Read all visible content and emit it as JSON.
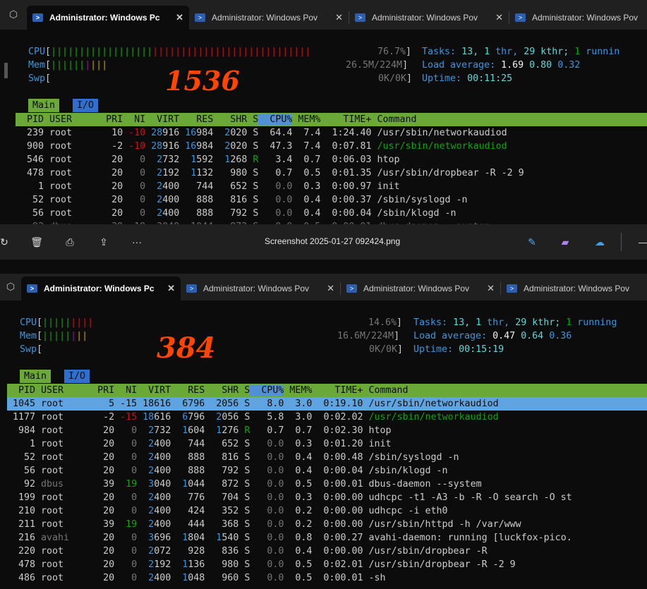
{
  "tabs": {
    "active_title": "Administrator: Windows Pc",
    "inactive_title": "Administrator: Windows Pov",
    "close_glyph": "✕"
  },
  "viewer": {
    "filename": "Screenshot 2025-01-27 092424.png",
    "more": "···"
  },
  "top": {
    "cpu_label": "CPU",
    "mem_label": "Mem",
    "swp_label": "Swp",
    "cpu_value": "76.7%",
    "mem_value": "26.5M/224M",
    "swp_value": "0K/0K",
    "tasks_label": "Tasks:",
    "tasks_text": "13,",
    "thr_value": "1",
    "thr_label": "thr,",
    "kthr_text": "29 kthr;",
    "running_value": "1",
    "running_label": "runnin",
    "load_label": "Load average:",
    "load1": "1.69",
    "load5": "0.80",
    "load15": "0.32",
    "uptime_label": "Uptime:",
    "uptime_value": "00:11:25",
    "annotation": "1536",
    "tab_main": "Main",
    "tab_io": "I/O",
    "rows": [
      [
        "239",
        "root",
        "10",
        "-10",
        "28916",
        "16984",
        "2020",
        "S",
        "64.4",
        "7.4",
        "1:24.40",
        "/usr/sbin/networkaudiod"
      ],
      [
        "900",
        "root",
        "-2",
        "-10",
        "28916",
        "16984",
        "2020",
        "S",
        "47.3",
        "7.4",
        "0:07.81",
        "/usr/sbin/networkaudiod"
      ],
      [
        "546",
        "root",
        "20",
        "0",
        "2732",
        "1592",
        "1268",
        "R",
        "3.4",
        "0.7",
        "0:06.03",
        "htop"
      ],
      [
        "478",
        "root",
        "20",
        "0",
        "2192",
        "1132",
        "980",
        "S",
        "0.7",
        "0.5",
        "0:01.35",
        "/usr/sbin/dropbear -R -2 9"
      ],
      [
        "1",
        "root",
        "20",
        "0",
        "2400",
        "744",
        "652",
        "S",
        "0.0",
        "0.3",
        "0:00.97",
        "init"
      ],
      [
        "52",
        "root",
        "20",
        "0",
        "2400",
        "888",
        "816",
        "S",
        "0.0",
        "0.4",
        "0:00.37",
        "/sbin/syslogd -n"
      ],
      [
        "56",
        "root",
        "20",
        "0",
        "2400",
        "888",
        "792",
        "S",
        "0.0",
        "0.4",
        "0:00.04",
        "/sbin/klogd -n"
      ]
    ]
  },
  "bottom": {
    "cpu_label": "CPU",
    "mem_label": "Mem",
    "swp_label": "Swp",
    "cpu_value": "14.6%",
    "mem_value": "16.6M/224M",
    "swp_value": "0K/0K",
    "tasks_label": "Tasks:",
    "tasks_text": "13,",
    "thr_value": "1",
    "thr_label": "thr,",
    "kthr_text": "29 kthr;",
    "running_value": "1",
    "running_label": "running",
    "load_label": "Load average:",
    "load1": "0.47",
    "load5": "0.64",
    "load15": "0.36",
    "uptime_label": "Uptime:",
    "uptime_value": "00:15:19",
    "annotation": "384",
    "tab_main": "Main",
    "tab_io": "I/O",
    "rows": [
      [
        "1045",
        "root",
        "5",
        "-15",
        "18616",
        "6796",
        "2056",
        "S",
        "8.0",
        "3.0",
        "0:19.10",
        "/usr/sbin/networkaudiod"
      ],
      [
        "1177",
        "root",
        "-2",
        "-15",
        "18616",
        "6796",
        "2056",
        "S",
        "5.8",
        "3.0",
        "0:02.02",
        "/usr/sbin/networkaudiod"
      ],
      [
        "984",
        "root",
        "20",
        "0",
        "2732",
        "1604",
        "1276",
        "R",
        "0.7",
        "0.7",
        "0:02.30",
        "htop"
      ],
      [
        "1",
        "root",
        "20",
        "0",
        "2400",
        "744",
        "652",
        "S",
        "0.0",
        "0.3",
        "0:01.20",
        "init"
      ],
      [
        "52",
        "root",
        "20",
        "0",
        "2400",
        "888",
        "816",
        "S",
        "0.0",
        "0.4",
        "0:00.48",
        "/sbin/syslogd -n"
      ],
      [
        "56",
        "root",
        "20",
        "0",
        "2400",
        "888",
        "792",
        "S",
        "0.0",
        "0.4",
        "0:00.04",
        "/sbin/klogd -n"
      ],
      [
        "92",
        "dbus",
        "39",
        "19",
        "3040",
        "1044",
        "872",
        "S",
        "0.0",
        "0.5",
        "0:00.01",
        "dbus-daemon --system"
      ],
      [
        "199",
        "root",
        "20",
        "0",
        "2400",
        "776",
        "704",
        "S",
        "0.0",
        "0.3",
        "0:00.00",
        "udhcpc -t1 -A3 -b -R -O search -O st"
      ],
      [
        "210",
        "root",
        "20",
        "0",
        "2400",
        "424",
        "352",
        "S",
        "0.0",
        "0.2",
        "0:00.00",
        "udhcpc -i eth0"
      ],
      [
        "211",
        "root",
        "39",
        "19",
        "2400",
        "444",
        "368",
        "S",
        "0.0",
        "0.2",
        "0:00.00",
        "/usr/sbin/httpd -h /var/www"
      ],
      [
        "216",
        "avahi",
        "20",
        "0",
        "3696",
        "1804",
        "1540",
        "S",
        "0.0",
        "0.8",
        "0:00.27",
        "avahi-daemon: running [luckfox-pico."
      ],
      [
        "220",
        "root",
        "20",
        "0",
        "2072",
        "928",
        "836",
        "S",
        "0.0",
        "0.4",
        "0:00.00",
        "/usr/sbin/dropbear -R"
      ],
      [
        "478",
        "root",
        "20",
        "0",
        "2192",
        "1136",
        "980",
        "S",
        "0.0",
        "0.5",
        "0:02.01",
        "/usr/sbin/dropbear -R -2 9"
      ],
      [
        "486",
        "root",
        "20",
        "0",
        "2400",
        "1048",
        "960",
        "S",
        "0.0",
        "0.5",
        "0:00.01",
        "-sh"
      ]
    ]
  },
  "header_cols": [
    "PID",
    "USER",
    "PRI",
    "NI",
    "VIRT",
    "RES",
    "SHR",
    "S",
    "CPU%",
    "MEM%",
    "TIME+",
    "Command"
  ],
  "partial_row": "   92 dbus       39  19  3040  1044   872 S   0.0  0.5  0:00.01 dbus-daemon --system",
  "colors": {
    "terminal_bg": "#0c0c0c",
    "header_green": "#6aa838",
    "selected_blue": "#5fa4e0",
    "annotation_orange": "#ff4500"
  }
}
